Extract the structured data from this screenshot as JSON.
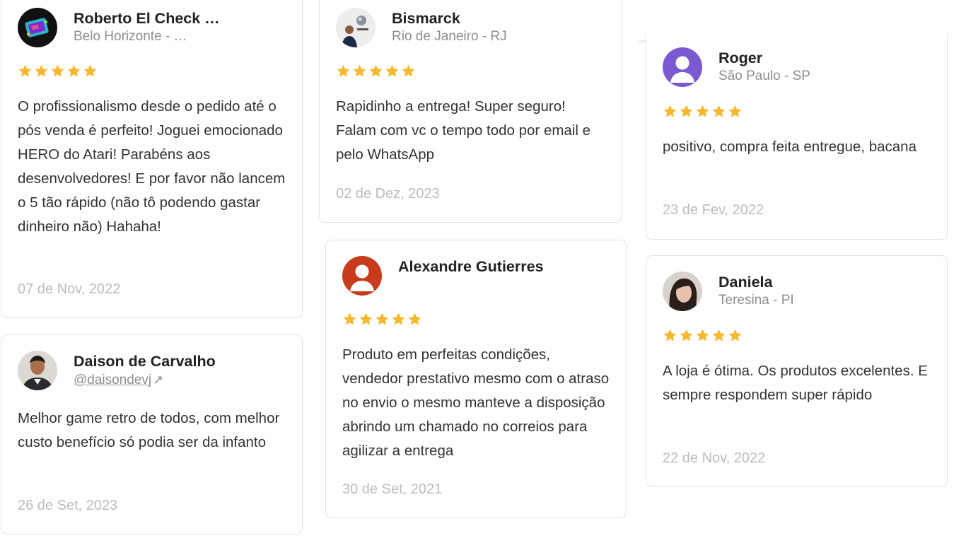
{
  "colors": {
    "star": "#f5b82e",
    "date": "#bcbcbc",
    "muted": "#8e8e8e",
    "border": "#e3e3e3"
  },
  "reviews": [
    {
      "name": "Roberto El Check …",
      "location": "Belo Horizonte - …",
      "rating": 5,
      "text": "O profissionalismo desde o pedido até o pós venda é perfeito! Joguei emocionado HERO do Atari! Parabéns aos desenvolvedores! E por favor não lancem o 5 tão rápido (não tô podendo gastar dinheiro não) Hahaha!",
      "date": "07 de Nov, 2022",
      "avatar": "game-console-avatar"
    },
    {
      "name": "Daison de Carvalho",
      "handle": "@daisondevj",
      "handle_icon": "external-link-icon",
      "text": "Melhor game retro de todos, com melhor custo benefício só podia ser da infanto",
      "date": "26 de Set, 2023",
      "avatar": "man-photo-avatar"
    },
    {
      "name": "Bismarck",
      "location": "Rio de Janeiro - RJ",
      "rating": 5,
      "text": "Rapidinho a entrega! Super seguro! Falam com vc o tempo todo por email e pelo WhatsApp",
      "date": "02 de Dez, 2023",
      "avatar": "man-photo-avatar"
    },
    {
      "name": "Alexandre Gutierres",
      "rating": 5,
      "text": "Produto em perfeitas condições, vendedor prestativo mesmo com o atraso no envio o mesmo manteve a disposição abrindo um chamado no correios para agilizar a entrega",
      "date": "30 de Set, 2021",
      "avatar": "default-user-avatar",
      "avatar_color": "#c83a1c"
    },
    {
      "name": "Roger",
      "location": "São Paulo - SP",
      "rating": 5,
      "text": "positivo, compra feita entregue, bacana",
      "date": "23 de Fev, 2022",
      "avatar": "default-user-avatar",
      "avatar_color": "#7b5ad1"
    },
    {
      "name": "Daniela",
      "location": "Teresina - PI",
      "rating": 5,
      "text": "A loja é ótima. Os produtos excelentes. E sempre respondem super rápido",
      "date": "22 de Nov, 2022",
      "avatar": "woman-photo-avatar"
    }
  ]
}
